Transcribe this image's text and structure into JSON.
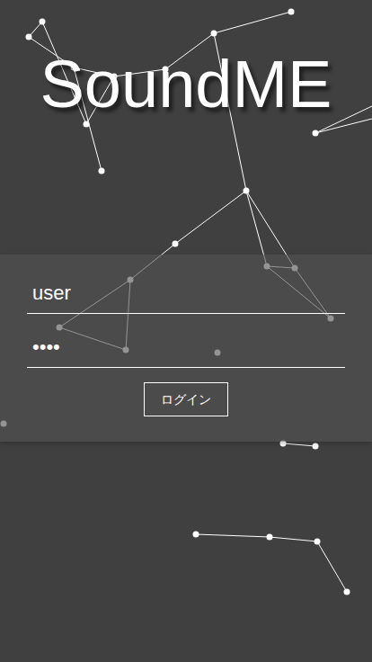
{
  "app": {
    "title": "SoundME"
  },
  "form": {
    "username": {
      "value": "user"
    },
    "password": {
      "value": "••••"
    },
    "buttons": [
      "ログイン"
    ]
  }
}
